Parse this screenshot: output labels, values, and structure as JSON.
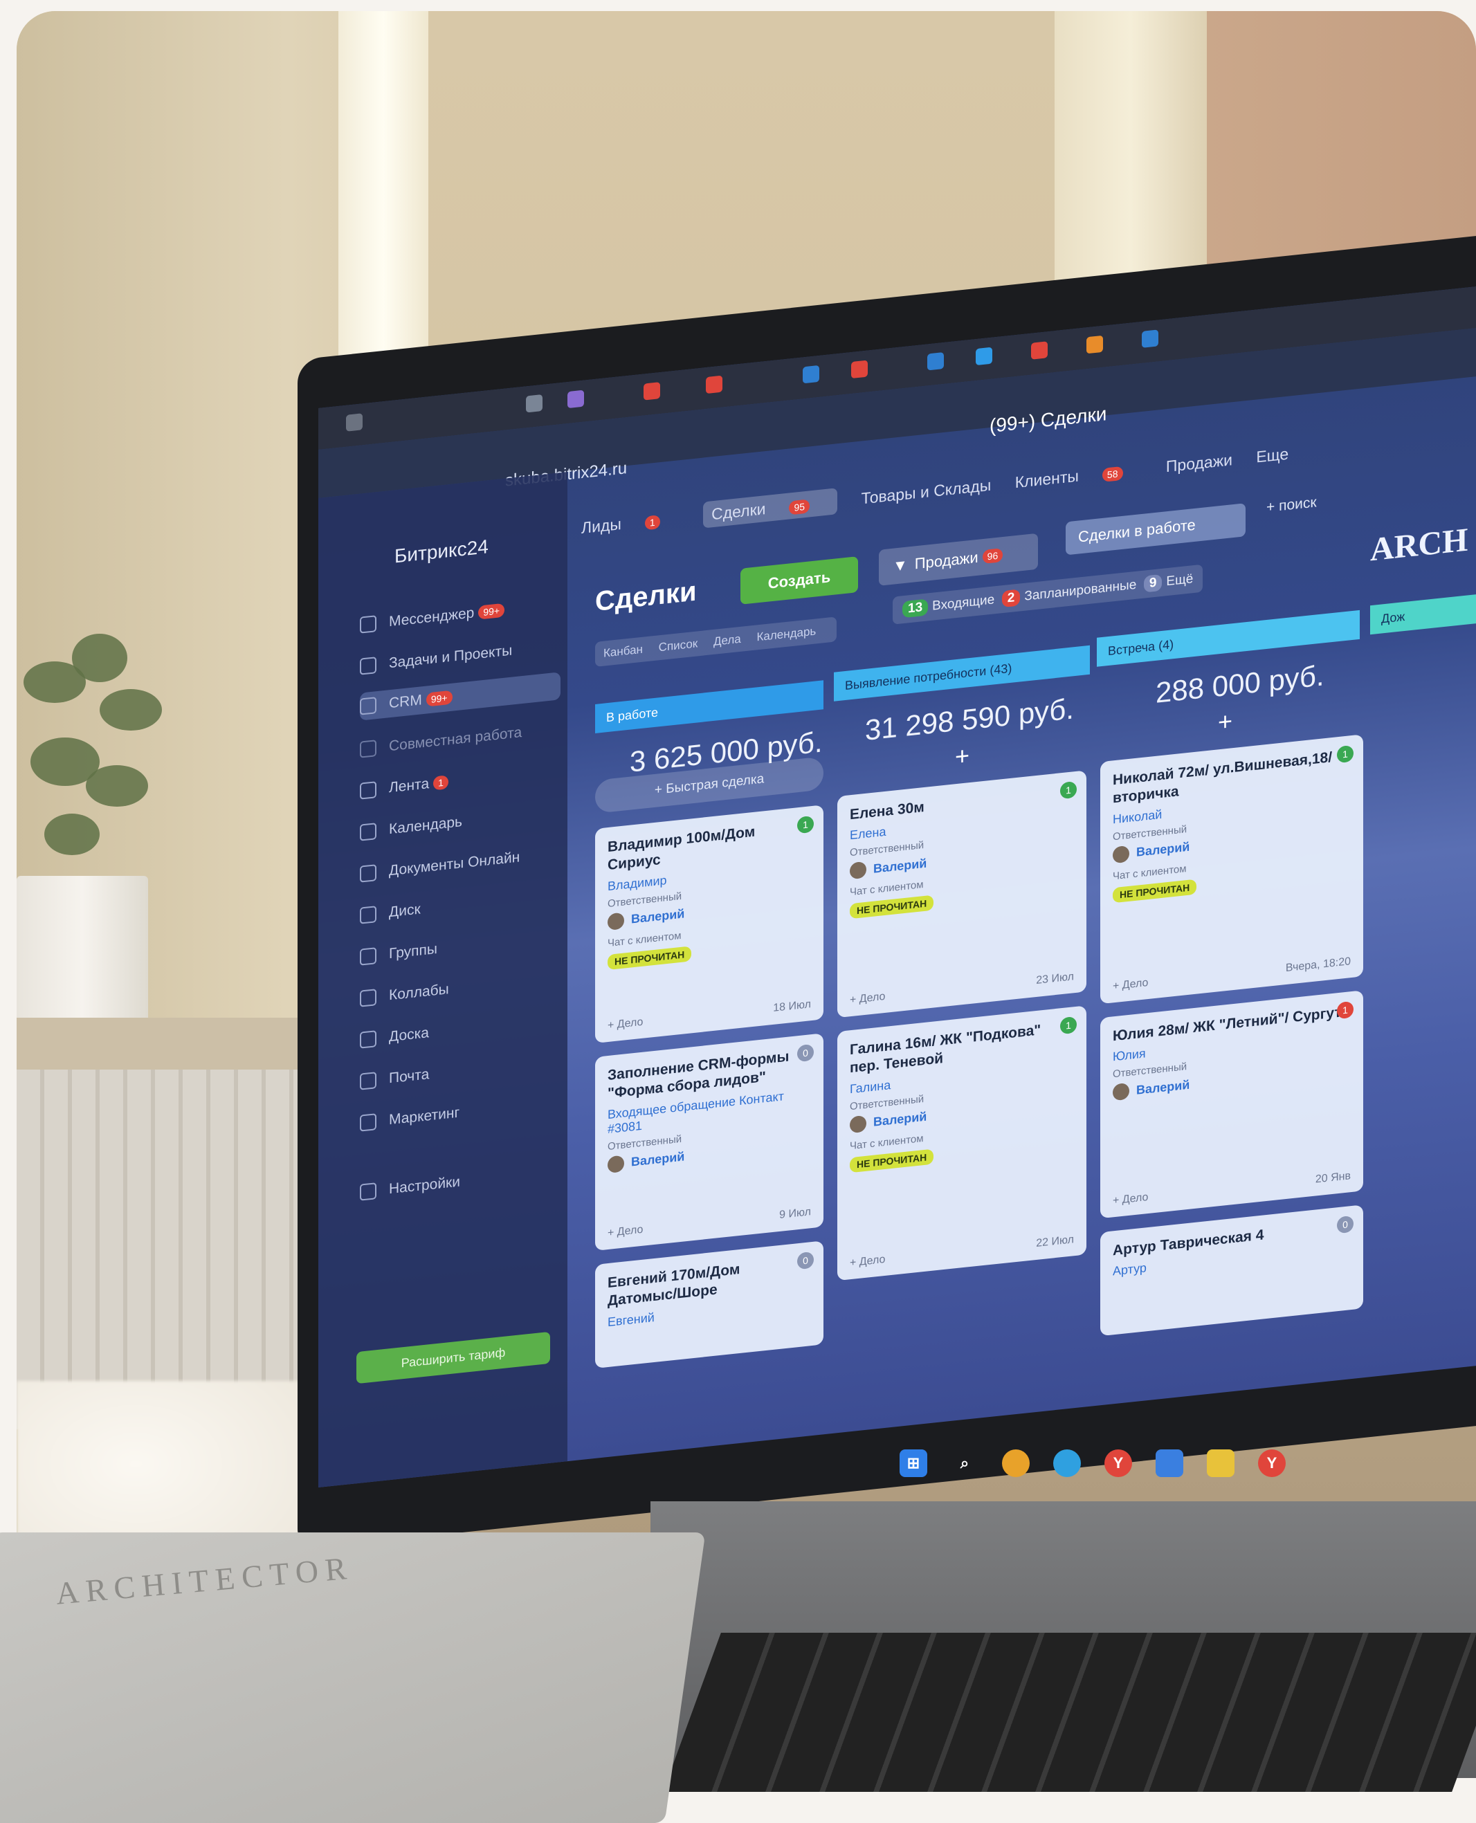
{
  "browser": {
    "url": "skuba.bitrix24.ru",
    "title": "(99+) Сделки"
  },
  "app": {
    "brand": "Битрикс24",
    "logo": "ARCH"
  },
  "sidebar": {
    "items": [
      {
        "label": "Мессенджер",
        "badge": "99+"
      },
      {
        "label": "Задачи и Проекты",
        "badge": ""
      },
      {
        "label": "CRM",
        "badge": "99+"
      },
      {
        "label": "Совместная работа",
        "badge": ""
      },
      {
        "label": "Лента",
        "badge": "1"
      },
      {
        "label": "Календарь",
        "badge": ""
      },
      {
        "label": "Документы Онлайн",
        "badge": ""
      },
      {
        "label": "Диск",
        "badge": ""
      },
      {
        "label": "Группы",
        "badge": ""
      },
      {
        "label": "Коллабы",
        "badge": ""
      },
      {
        "label": "Доска",
        "badge": ""
      },
      {
        "label": "Почта",
        "badge": ""
      },
      {
        "label": "Маркетинг",
        "badge": ""
      },
      {
        "label": "Настройки",
        "badge": ""
      }
    ],
    "upgrade_label": "Расширить тариф"
  },
  "topnav": {
    "items": [
      {
        "label": "Лиды",
        "badge": "1"
      },
      {
        "label": "Сделки",
        "badge": "95"
      },
      {
        "label": "Товары и Склады",
        "badge": ""
      },
      {
        "label": "Клиенты",
        "badge": "58"
      },
      {
        "label": "Продажи",
        "badge": ""
      },
      {
        "label": "Еще",
        "badge": ""
      }
    ]
  },
  "toolbar": {
    "page_title": "Сделки",
    "create_label": "Создать",
    "pipeline_label": "Продажи",
    "pipeline_badge": "96",
    "filter_label": "Сделки в работе",
    "search_placeholder": "+ поиск",
    "views": [
      "Канбан",
      "Список",
      "Дела",
      "Календарь"
    ],
    "counters": [
      {
        "count": "13",
        "label": "Входящие",
        "color": "#3aa852"
      },
      {
        "count": "2",
        "label": "Запланированные",
        "color": "#e0453b"
      },
      {
        "count": "9",
        "label": "Ещё",
        "color": "#7a88b8"
      }
    ]
  },
  "columns": [
    {
      "name": "В работе",
      "count": "",
      "sum": "3 625 000 руб.",
      "color": "#2f9be8"
    },
    {
      "name": "Выявление потребности",
      "count": "43",
      "sum": "31 298 590 руб.",
      "color": "#3fb3ee"
    },
    {
      "name": "Встреча",
      "count": "4",
      "sum": "288 000 руб.",
      "color": "#4cc3f0"
    },
    {
      "name": "Дож",
      "count": "",
      "sum": "",
      "color": "#4fd4c9"
    }
  ],
  "quick_add_label": "+ Быстрая сделка",
  "cards": [
    {
      "title": "Владимир 100м/Дом Сириус",
      "contact": "Владимир",
      "role": "Ответственный",
      "user": "Валерий",
      "chat": "Чат с клиентом",
      "pill": "НЕ ПРОЧИТАН",
      "action": "+ Дело",
      "date": "18 Июл",
      "count": "1",
      "count_color": "#3aa852"
    },
    {
      "title": "Заполнение CRM-формы \"Форма сбора лидов\"",
      "contact": "Входящее обращение Контакт #3081",
      "role": "Ответственный",
      "user": "Валерий",
      "chat": "",
      "pill": "",
      "action": "+ Дело",
      "date": "9 Июл",
      "count": "0",
      "count_color": "#8a96b4"
    },
    {
      "title": "Евгений 170м/Дом Датомыс/Шоре",
      "contact": "Евгений",
      "role": "",
      "user": "",
      "chat": "",
      "pill": "",
      "action": "",
      "date": "",
      "count": "0",
      "count_color": "#8a96b4"
    },
    {
      "title": "Елена 30м",
      "contact": "Елена",
      "role": "Ответственный",
      "user": "Валерий",
      "chat": "Чат с клиентом",
      "pill": "НЕ ПРОЧИТАН",
      "action": "+ Дело",
      "date": "23 Июл",
      "count": "1",
      "count_color": "#3aa852"
    },
    {
      "title": "Галина 16м/ ЖК \"Подкова\" пер. Теневой",
      "contact": "Галина",
      "role": "Ответственный",
      "user": "Валерий",
      "chat": "Чат с клиентом",
      "pill": "НЕ ПРОЧИТАН",
      "action": "+ Дело",
      "date": "22 Июл",
      "count": "1",
      "count_color": "#3aa852"
    },
    {
      "title": "Николай 72м/ ул.Вишневая,18/вторичка",
      "contact": "Николай",
      "role": "Ответственный",
      "user": "Валерий",
      "chat": "Чат с клиентом",
      "pill": "НЕ ПРОЧИТАН",
      "action": "+ Дело",
      "date": "Вчера, 18:20",
      "count": "1",
      "count_color": "#3aa852"
    },
    {
      "title": "Юлия 28м/ ЖК \"Летний\"/ Сургут",
      "contact": "Юлия",
      "role": "Ответственный",
      "user": "Валерий",
      "chat": "",
      "pill": "",
      "action": "+ Дело",
      "date": "20 Янв",
      "count": "1",
      "count_color": "#e0453b"
    },
    {
      "title": "Артур Таврическая 4",
      "contact": "Артур",
      "role": "",
      "user": "",
      "chat": "",
      "pill": "",
      "action": "",
      "date": "",
      "count": "0",
      "count_color": "#8a96b4"
    }
  ],
  "notebook": {
    "brand": "ARCHITECTOR"
  }
}
